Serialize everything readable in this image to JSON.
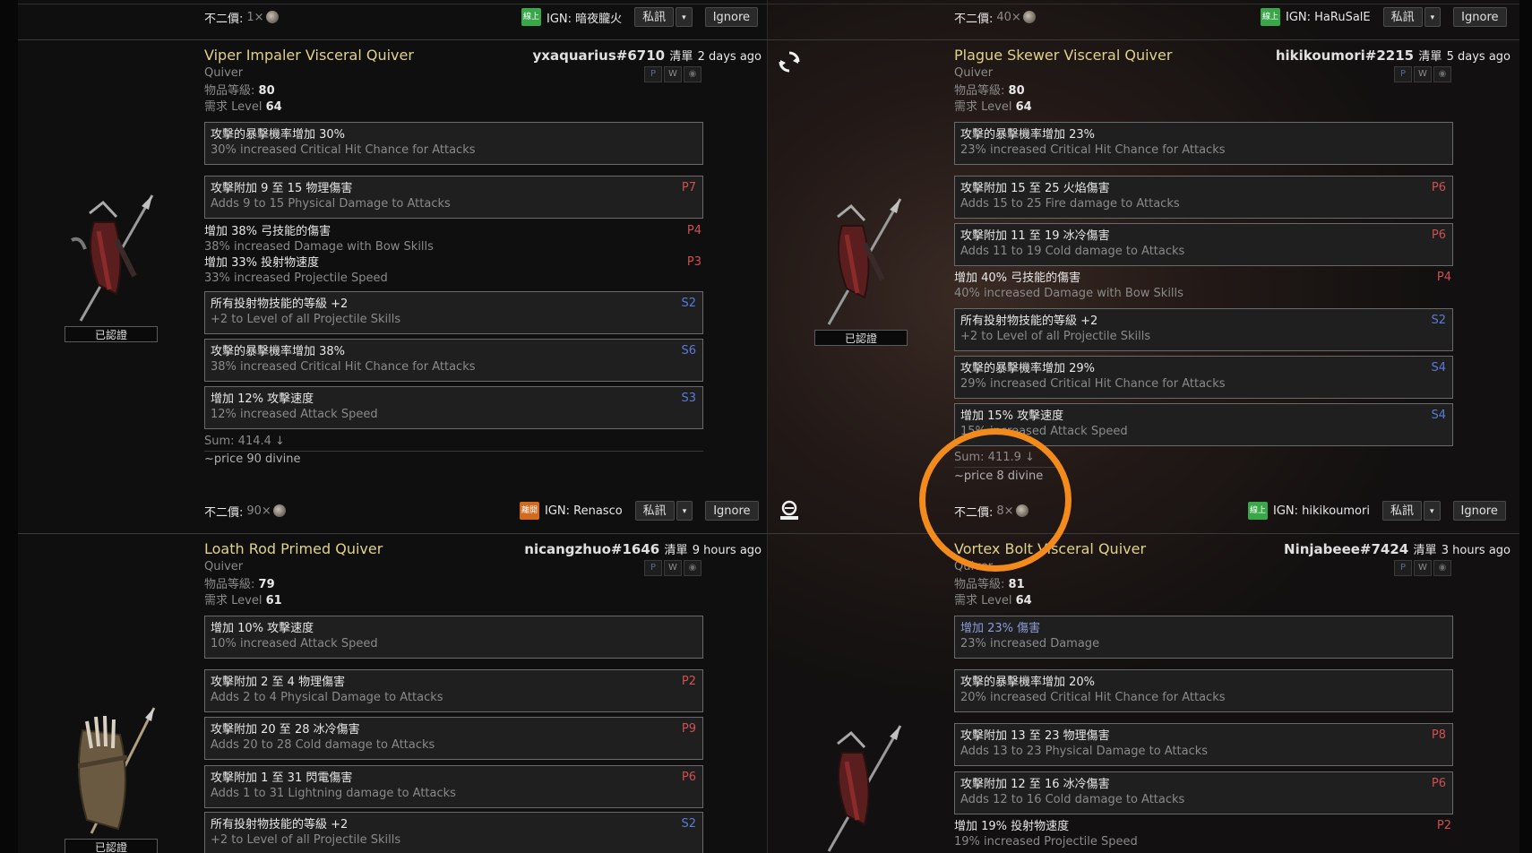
{
  "listings": [
    {
      "top": {
        "price_label": "不二價:",
        "price_value": "1×",
        "ign": "IGN: 暗夜朧火",
        "online": "線上"
      },
      "name": "Viper Impaler Visceral Quiver",
      "seller": "yxaquarius#6710",
      "listed_label": "清單",
      "listed_time": "2 days ago",
      "base": "Quiver",
      "ilvl_label": "物品等級:",
      "ilvl": "80",
      "req_label": "需求 Level",
      "req": "64",
      "verified": "已認證",
      "mods": [
        {
          "zh": "攻擊的暴擊機率增加 30%",
          "en": "30% increased Critical Hit Chance for Attacks",
          "tag": ""
        },
        {
          "zh": "攻擊附加 9 至 15 物理傷害",
          "en": "Adds 9 to 15 Physical Damage to Attacks",
          "tag": "P7"
        },
        {
          "zh": "增加 38% 弓技能的傷害",
          "en": "38% increased Damage with Bow Skills",
          "tag": "P4"
        },
        {
          "zh": "增加 33% 投射物速度",
          "en": "33% increased Projectile Speed",
          "tag": "P3"
        },
        {
          "zh": "所有投射物技能的等級 +2",
          "en": "+2 to Level of all Projectile Skills",
          "tag": "S2"
        },
        {
          "zh": "攻擊的暴擊機率增加 38%",
          "en": "38% increased Critical Hit Chance for Attacks",
          "tag": "S6"
        },
        {
          "zh": "增加 12% 攻擊速度",
          "en": "12% increased Attack Speed",
          "tag": "S3"
        }
      ],
      "sum": "Sum: 414.4 ↓",
      "price": "~price 90 divine"
    },
    {
      "top": {
        "price_label": "不二價:",
        "price_value": "40×",
        "ign": "IGN: HaRuSalE",
        "online": "線上"
      },
      "name": "Plague Skewer Visceral Quiver",
      "seller": "hikikoumori#2215",
      "listed_label": "清單",
      "listed_time": "5 days ago",
      "base": "Quiver",
      "ilvl_label": "物品等級:",
      "ilvl": "80",
      "req_label": "需求 Level",
      "req": "64",
      "verified": "已認證",
      "mods": [
        {
          "zh": "攻擊的暴擊機率增加 23%",
          "en": "23% increased Critical Hit Chance for Attacks",
          "tag": ""
        },
        {
          "zh": "攻擊附加 15 至 25 火焰傷害",
          "en": "Adds 15 to 25 Fire damage to Attacks",
          "tag": "P6"
        },
        {
          "zh": "攻擊附加 11 至 19 冰冷傷害",
          "en": "Adds 11 to 19 Cold damage to Attacks",
          "tag": "P6"
        },
        {
          "zh": "增加 40% 弓技能的傷害",
          "en": "40% increased Damage with Bow Skills",
          "tag": "P4"
        },
        {
          "zh": "所有投射物技能的等級 +2",
          "en": "+2 to Level of all Projectile Skills",
          "tag": "S2"
        },
        {
          "zh": "攻擊的暴擊機率增加 29%",
          "en": "29% increased Critical Hit Chance for Attacks",
          "tag": "S4"
        },
        {
          "zh": "增加 15% 攻擊速度",
          "en": "15% increased Attack Speed",
          "tag": "S4"
        }
      ],
      "sum": "Sum: 411.9 ↓",
      "price": "~price 8 divine"
    },
    {
      "top": {
        "price_label": "不二價:",
        "price_value": "90×",
        "ign": "IGN: Renasco",
        "online": "離開"
      },
      "name": "Loath Rod Primed Quiver",
      "seller": "nicangzhuo#1646",
      "listed_label": "清單",
      "listed_time": "9 hours ago",
      "base": "Quiver",
      "ilvl_label": "物品等級:",
      "ilvl": "79",
      "req_label": "需求 Level",
      "req": "61",
      "verified": "已認證",
      "mods": [
        {
          "zh": "增加 10% 攻擊速度",
          "en": "10% increased Attack Speed",
          "tag": ""
        },
        {
          "zh": "攻擊附加 2 至 4 物理傷害",
          "en": "Adds 2 to 4 Physical Damage to Attacks",
          "tag": "P2"
        },
        {
          "zh": "攻擊附加 20 至 28 冰冷傷害",
          "en": "Adds 20 to 28 Cold damage to Attacks",
          "tag": "P9"
        },
        {
          "zh": "攻擊附加 1 至 31 閃電傷害",
          "en": "Adds 1 to 31 Lightning damage to Attacks",
          "tag": "P6"
        },
        {
          "zh": "所有投射物技能的等級 +2",
          "en": "+2 to Level of all Projectile Skills",
          "tag": "S2"
        }
      ]
    },
    {
      "top": {
        "price_label": "不二價:",
        "price_value": "8×",
        "ign": "IGN: hikikoumori",
        "online": "線上"
      },
      "name": "Vortex Bolt Visceral Quiver",
      "seller": "Ninjabeee#7424",
      "listed_label": "清單",
      "listed_time": "3 hours ago",
      "base": "Quiver",
      "ilvl_label": "物品等級:",
      "ilvl": "81",
      "req_label": "需求 Level",
      "req": "64",
      "mods": [
        {
          "zh": "增加 23% 傷害",
          "en": "23% increased Damage",
          "tag": ""
        },
        {
          "zh": "攻擊的暴擊機率增加 20%",
          "en": "20% increased Critical Hit Chance for Attacks",
          "tag": ""
        },
        {
          "zh": "攻擊附加 13 至 23 物理傷害",
          "en": "Adds 13 to 23 Physical Damage to Attacks",
          "tag": "P8"
        },
        {
          "zh": "攻擊附加 12 至 16 冰冷傷害",
          "en": "Adds 12 to 16 Cold damage to Attacks",
          "tag": "P6"
        },
        {
          "zh": "增加 19% 投射物速度",
          "en": "19% increased Projectile Speed",
          "tag": "P2"
        }
      ]
    }
  ],
  "buttons": {
    "whisper": "私訊",
    "caret": "▾",
    "ignore": "Ignore"
  },
  "pw": {
    "p": "P",
    "w": "W",
    "eye": "◉"
  },
  "colors": {
    "item_name": "#e0d28a",
    "prefix_tag": "#d05050",
    "suffix_tag": "#5a7ad6",
    "online_badge": "#3aa64a",
    "away_badge": "#d26a1e",
    "highlight_circle": "#f28a1c"
  }
}
